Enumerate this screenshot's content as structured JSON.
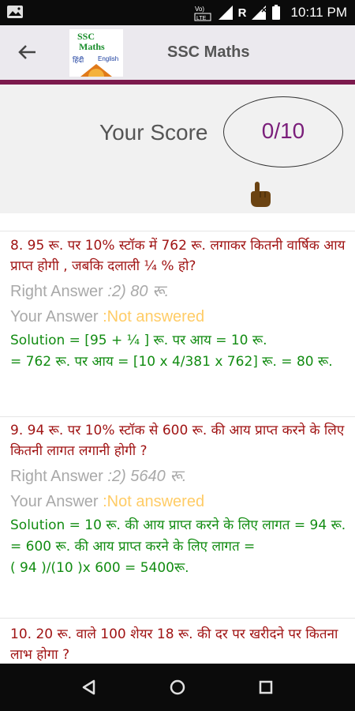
{
  "status_bar": {
    "time": "10:11 PM",
    "carrier_letter": "R",
    "icons": [
      "image-icon",
      "volte-icon",
      "signal-icon",
      "battery-icon"
    ]
  },
  "app_bar": {
    "title": "SSC Maths",
    "back_icon": "back-arrow-icon",
    "logo": {
      "line1": "SSC",
      "line2": "Maths",
      "line3": "हिंदी",
      "line4": "English"
    },
    "divider_color": "#7c1a4d"
  },
  "score": {
    "label": "Your Score",
    "value": "0/10",
    "hand_icon": "pointing-hand-icon"
  },
  "questions": [
    {
      "text": "8. 95 रू. पर 10% स्टॉक में 762 रू. लगाकर कितनी वार्षिक आय प्राप्त होगी , जबकि दलाली ¼ % हो?",
      "right_label": "Right Answer",
      "right_value": " :2) 80 रू.",
      "your_label": "Your Answer",
      "your_value": " :Not answered",
      "solution": [
        "Solution = [95 + ¼ ] रू. पर आय = 10 रू.",
        "= 762 रू. पर आय = [10 x 4/381 x 762] रू. = 80 रू."
      ]
    },
    {
      "text": "9. 94 रू. पर 10% स्टॉक से 600 रू. की आय प्राप्त करने के लिए कितनी लागत लगानी होगी ?",
      "right_label": "Right Answer",
      "right_value": " :2) 5640 रू.",
      "your_label": "Your Answer",
      "your_value": " :Not answered",
      "solution": [
        "Solution = 10 रू. की आय प्राप्त करने के लिए लागत = 94 रू.",
        "= 600 रू. की आय प्राप्त करने के लिए लागत =",
        "( 94    )/(10 )x 600 = 5400रू."
      ]
    },
    {
      "text": "10. 20 रू. वाले 100 शेयर 18 रू. की दर पर खरीदने पर कितना लाभ होगा ?"
    }
  ],
  "nav_bar": {
    "icons": [
      "back-triangle-icon",
      "home-circle-icon",
      "recents-square-icon"
    ]
  },
  "colors": {
    "question": "#a01414",
    "solution": "#128c12",
    "answer_gray": "#a9a9a9",
    "your_answer": "#ffcc66",
    "score_value": "#7a1e7a"
  }
}
